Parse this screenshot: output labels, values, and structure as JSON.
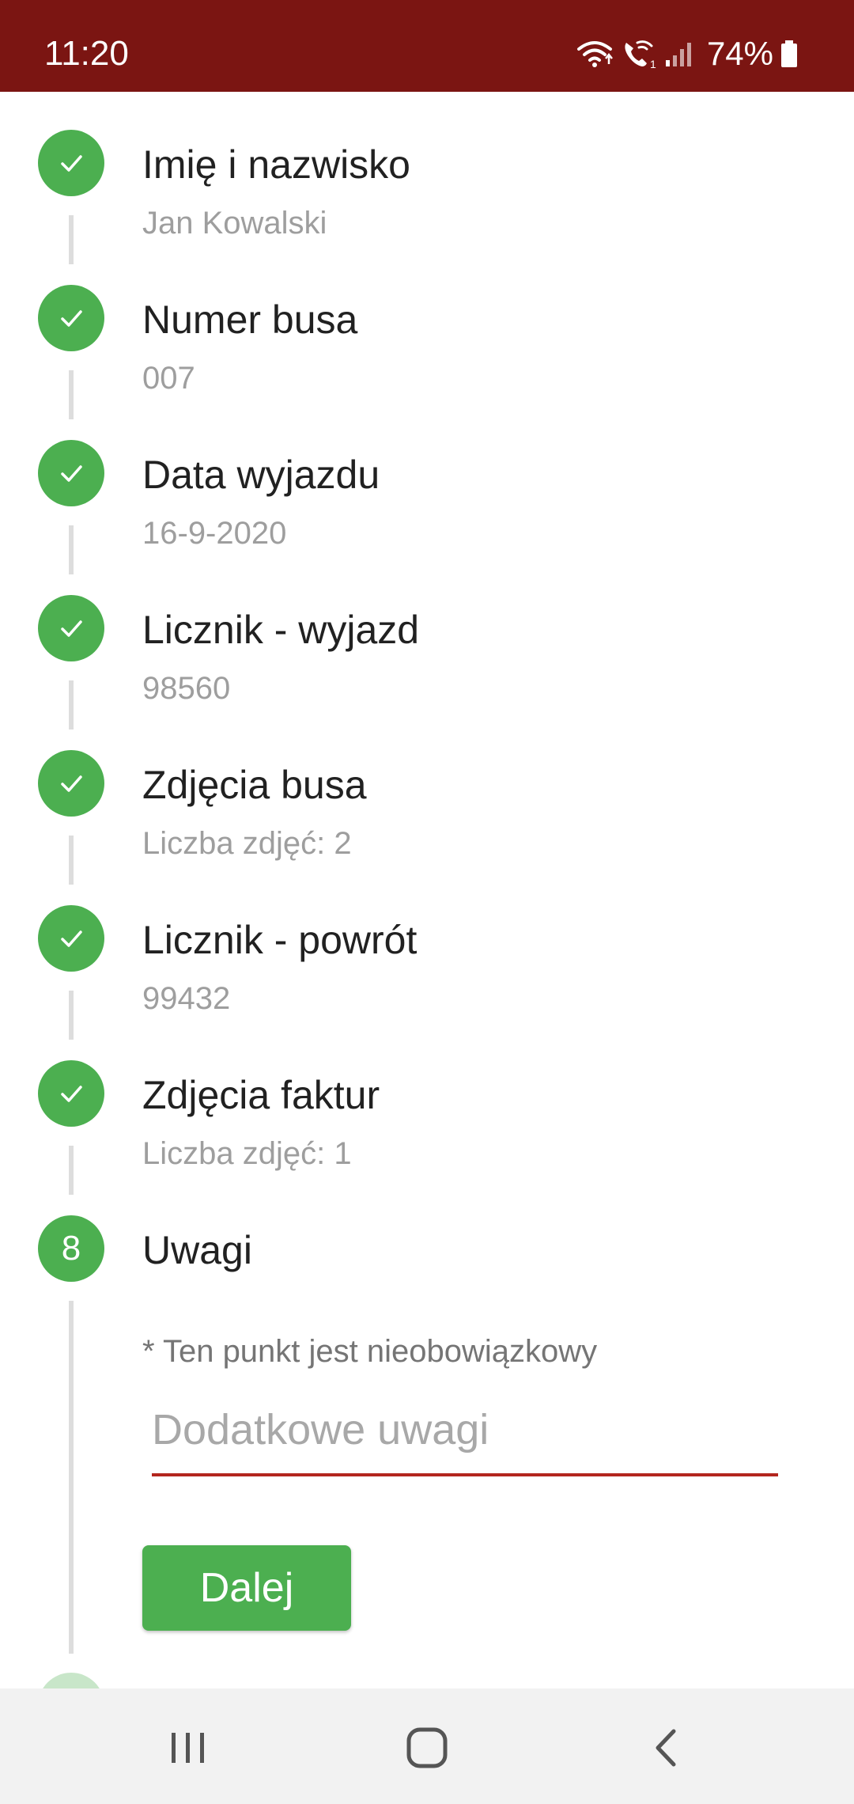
{
  "status_bar": {
    "time": "11:20",
    "battery_percent": "74%",
    "icons": [
      "wifi-icon",
      "wifi-call-icon",
      "signal-icon",
      "battery-icon"
    ],
    "background_color": "#7b1512"
  },
  "steps": [
    {
      "number": "1",
      "state": "done",
      "title": "Imię i nazwisko",
      "value": "Jan Kowalski"
    },
    {
      "number": "2",
      "state": "done",
      "title": "Numer busa",
      "value": "007"
    },
    {
      "number": "3",
      "state": "done",
      "title": "Data wyjazdu",
      "value": "16-9-2020"
    },
    {
      "number": "4",
      "state": "done",
      "title": "Licznik - wyjazd",
      "value": "98560"
    },
    {
      "number": "5",
      "state": "done",
      "title": "Zdjęcia busa",
      "value": "Liczba zdjęć: 2"
    },
    {
      "number": "6",
      "state": "done",
      "title": "Licznik - powrót",
      "value": "99432"
    },
    {
      "number": "7",
      "state": "done",
      "title": "Zdjęcia faktur",
      "value": "Liczba zdjęć: 1"
    },
    {
      "number": "8",
      "state": "active",
      "title": "Uwagi",
      "value": ""
    }
  ],
  "active_step": {
    "optional_note": "* Ten punkt jest nieobowiązkowy",
    "notes_input": {
      "placeholder": "Dodatkowe uwagi",
      "value": ""
    },
    "next_button_label": "Dalej"
  },
  "nav_bar": {
    "buttons": [
      "recent-apps-icon",
      "home-icon",
      "back-icon"
    ]
  },
  "colors": {
    "accent_green": "#4caf50",
    "input_underline": "#b3261e"
  }
}
